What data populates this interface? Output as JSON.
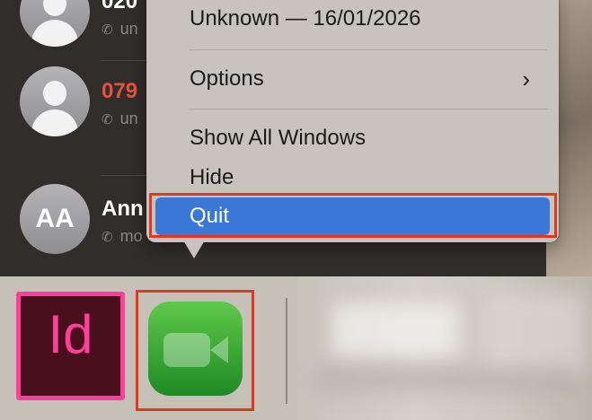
{
  "contacts": [
    {
      "name": "020",
      "subtitle": "un",
      "missed": false,
      "avatar": "person-icon"
    },
    {
      "name": "079",
      "subtitle": "un",
      "missed": true,
      "avatar": "person-icon"
    },
    {
      "name": "Ann",
      "subtitle": "mo",
      "missed": false,
      "avatar_initials": "AA"
    }
  ],
  "contact_sub_icon": "phone-icon",
  "menu": {
    "items": [
      {
        "label": "Unknown — 16/01/2026",
        "highlighted": false
      },
      {
        "label": "Options",
        "has_submenu": true,
        "submenu_glyph": "›",
        "highlighted": false
      },
      {
        "label": "Show All Windows",
        "highlighted": false
      },
      {
        "label": "Hide",
        "highlighted": false
      },
      {
        "label": "Quit",
        "highlighted": true
      }
    ]
  },
  "dock": {
    "apps": [
      {
        "name": "InDesign",
        "icon": "indesign-icon",
        "letters": "Id"
      },
      {
        "name": "FaceTime",
        "icon": "facetime-icon"
      }
    ]
  },
  "colors": {
    "menu_background": "#c9c3bf",
    "highlight_blue": "#3a78d8",
    "annotation_red": "#e03a1e",
    "missed_call_red": "#e5533f",
    "indesign_pink": "#ff3f9a",
    "facetime_green": "#34a83a"
  }
}
